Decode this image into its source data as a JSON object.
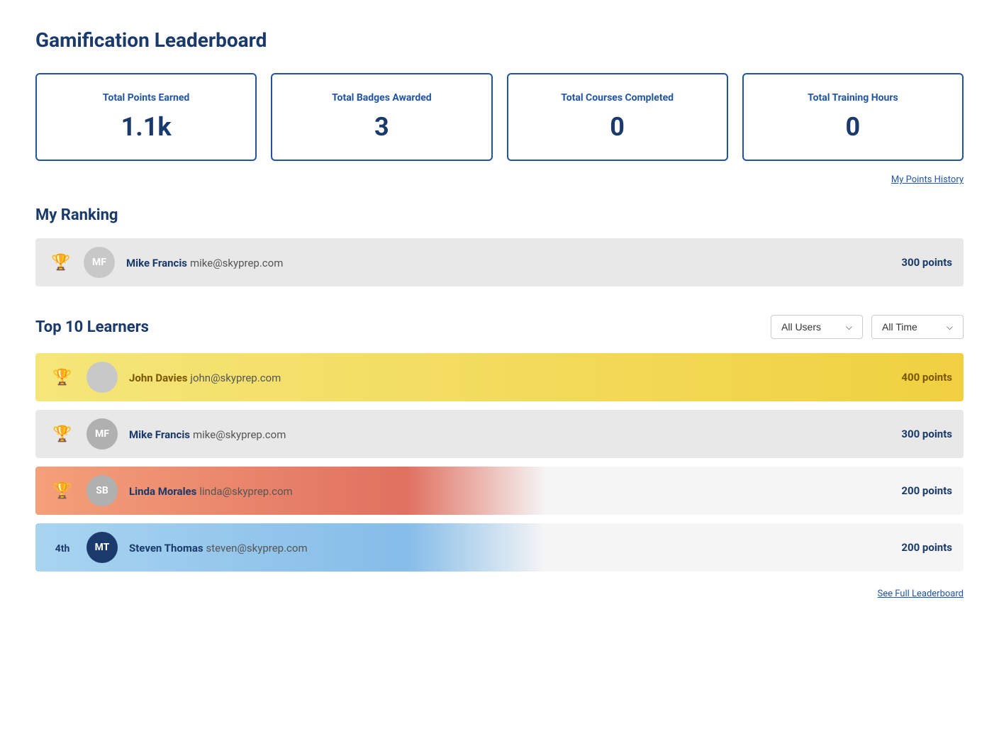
{
  "page": {
    "title": "Gamification Leaderboard"
  },
  "stats": [
    {
      "label": "Total Points Earned",
      "value": "1.1k"
    },
    {
      "label": "Total Badges Awarded",
      "value": "3"
    },
    {
      "label": "Total Courses Completed",
      "value": "0"
    },
    {
      "label": "Total Training Hours",
      "value": "0"
    }
  ],
  "points_history_link": "My Points History",
  "my_ranking": {
    "section_title": "My Ranking",
    "user": {
      "initials": "MF",
      "name": "Mike Francis",
      "email": "mike@skyprep.com",
      "points": "300 points"
    }
  },
  "top10": {
    "section_title": "Top 10 Learners",
    "filter_users_label": "All Users",
    "filter_time_label": "All Time",
    "learners": [
      {
        "rank": "1st",
        "rank_type": "gold_trophy",
        "initials": "",
        "name": "John Davies",
        "email": "john@skyprep.com",
        "points": "400 points",
        "style": "gold"
      },
      {
        "rank": "2nd",
        "rank_type": "silver_trophy",
        "initials": "MF",
        "name": "Mike Francis",
        "email": "mike@skyprep.com",
        "points": "300 points",
        "style": "gray"
      },
      {
        "rank": "3rd",
        "rank_type": "bronze_trophy",
        "initials": "SB",
        "name": "Linda Morales",
        "email": "linda@skyprep.com",
        "points": "200 points",
        "style": "red"
      },
      {
        "rank": "4th",
        "rank_type": "number",
        "initials": "MT",
        "name": "Steven Thomas",
        "email": "steven@skyprep.com",
        "points": "200 points",
        "style": "blue"
      }
    ]
  },
  "see_full_leaderboard": "See Full Leaderboard"
}
